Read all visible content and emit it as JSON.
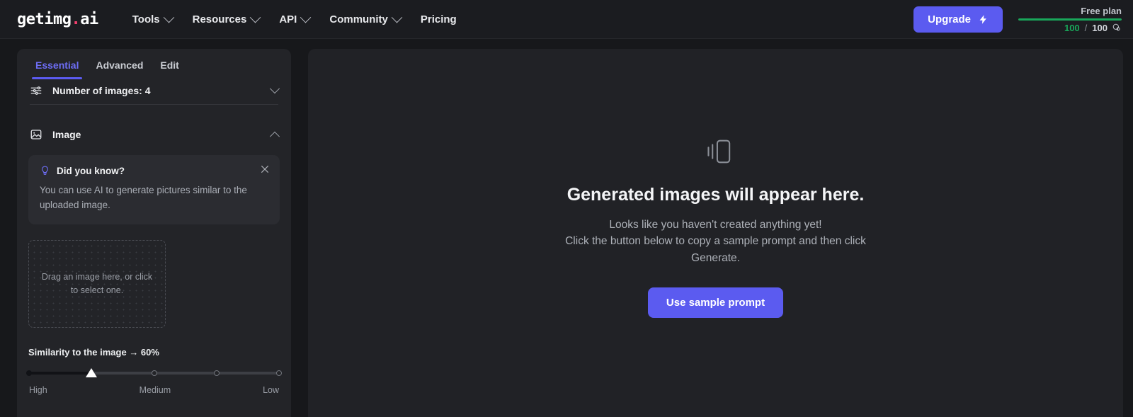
{
  "header": {
    "logo_text": "getimg",
    "logo_dot": ".",
    "logo_suffix": "ai",
    "nav": [
      {
        "label": "Tools",
        "has_caret": true
      },
      {
        "label": "Resources",
        "has_caret": true
      },
      {
        "label": "API",
        "has_caret": true
      },
      {
        "label": "Community",
        "has_caret": true
      },
      {
        "label": "Pricing",
        "has_caret": false
      }
    ],
    "upgrade_label": "Upgrade",
    "plan_label": "Free plan",
    "credits_used": "100",
    "credits_separator": "/",
    "credits_total": "100",
    "credits_percent": 100,
    "accent_color": "#5b5bf0",
    "credits_bar_color": "#19a75a",
    "logo_dot_color": "#f43f6e"
  },
  "sidebar": {
    "tabs": [
      {
        "label": "Essential",
        "active": true
      },
      {
        "label": "Advanced",
        "active": false
      },
      {
        "label": "Edit",
        "active": false
      }
    ],
    "sections": [
      {
        "title": "Number of images: 4",
        "icon": "sliders-icon",
        "expanded": false
      },
      {
        "title": "Image",
        "icon": "photo-icon",
        "expanded": true
      }
    ],
    "tip": {
      "title": "Did you know?",
      "body": "You can use AI to generate pictures similar to the uploaded image.",
      "close_icon": "close-icon",
      "bulb_icon": "lightbulb-icon"
    },
    "dropzone": {
      "text": "Drag an image here, or click to select one."
    },
    "slider": {
      "label": "Similarity to the image → 60%",
      "value_percent": 60,
      "thumb_position_percent": 25,
      "ticks_percent": [
        0,
        50,
        75,
        100
      ],
      "scale_labels": [
        "High",
        "Medium",
        "Low"
      ]
    }
  },
  "main": {
    "icon": "gallery-icon",
    "title": "Generated images will appear here.",
    "subtitle": "Looks like you haven't created anything yet!\nClick the button below to copy a sample prompt and then click Generate.",
    "button_label": "Use sample prompt"
  }
}
